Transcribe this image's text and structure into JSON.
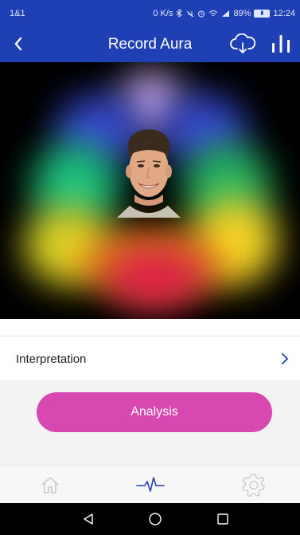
{
  "status_bar": {
    "left_text": "1&1",
    "network_speed": "0 K/s",
    "battery_percent": "89%",
    "battery_level": 0.89,
    "time": "12:24"
  },
  "header": {
    "title": "Record Aura",
    "back_icon": "chevron-left-icon",
    "cloud_icon": "cloud-download-icon",
    "chart_icon": "bar-chart-icon"
  },
  "aura": {
    "colors": [
      "#d9b7ff",
      "#3a4fe0",
      "#1fd38a",
      "#7fdc28",
      "#ffe02a",
      "#ff9a1a",
      "#ff2d2d",
      "#e0204a"
    ]
  },
  "interpretation": {
    "label": "Interpretation",
    "chevron_icon": "chevron-right-icon"
  },
  "analysis_button": {
    "label": "Analysis",
    "color": "#d749b1"
  },
  "tabs": [
    {
      "icon": "home-icon",
      "active": false
    },
    {
      "icon": "pulse-icon",
      "active": true
    },
    {
      "icon": "settings-gear-icon",
      "active": false
    }
  ],
  "colors": {
    "brand_blue": "#1f3fb5",
    "accent_pink": "#d749b1"
  }
}
